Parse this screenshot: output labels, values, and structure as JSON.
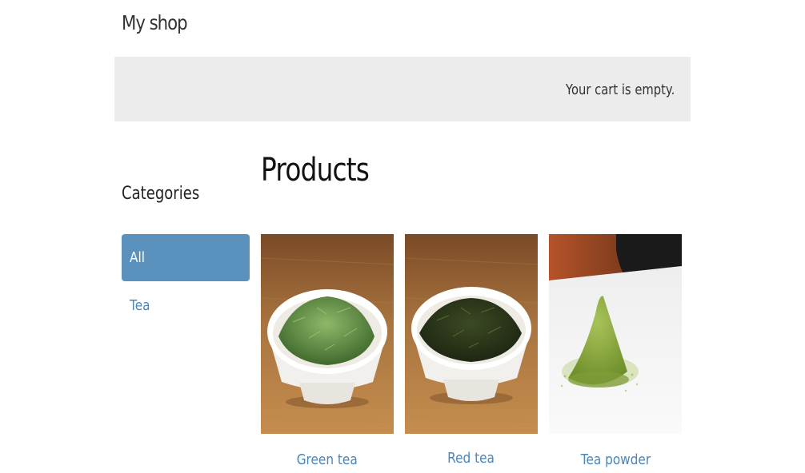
{
  "header": {
    "site_title": "My shop"
  },
  "cart": {
    "status_text": "Your cart is empty."
  },
  "sidebar": {
    "title": "Categories",
    "items": [
      {
        "label": "All",
        "active": true
      },
      {
        "label": "Tea",
        "active": false
      }
    ]
  },
  "main": {
    "title": "Products",
    "products": [
      {
        "name": "Green tea"
      },
      {
        "name": "Red tea"
      },
      {
        "name": "Tea powder"
      }
    ]
  },
  "colors": {
    "accent": "#5b92bd",
    "link": "#4a86b8",
    "cart_bar_bg": "#ececec"
  }
}
